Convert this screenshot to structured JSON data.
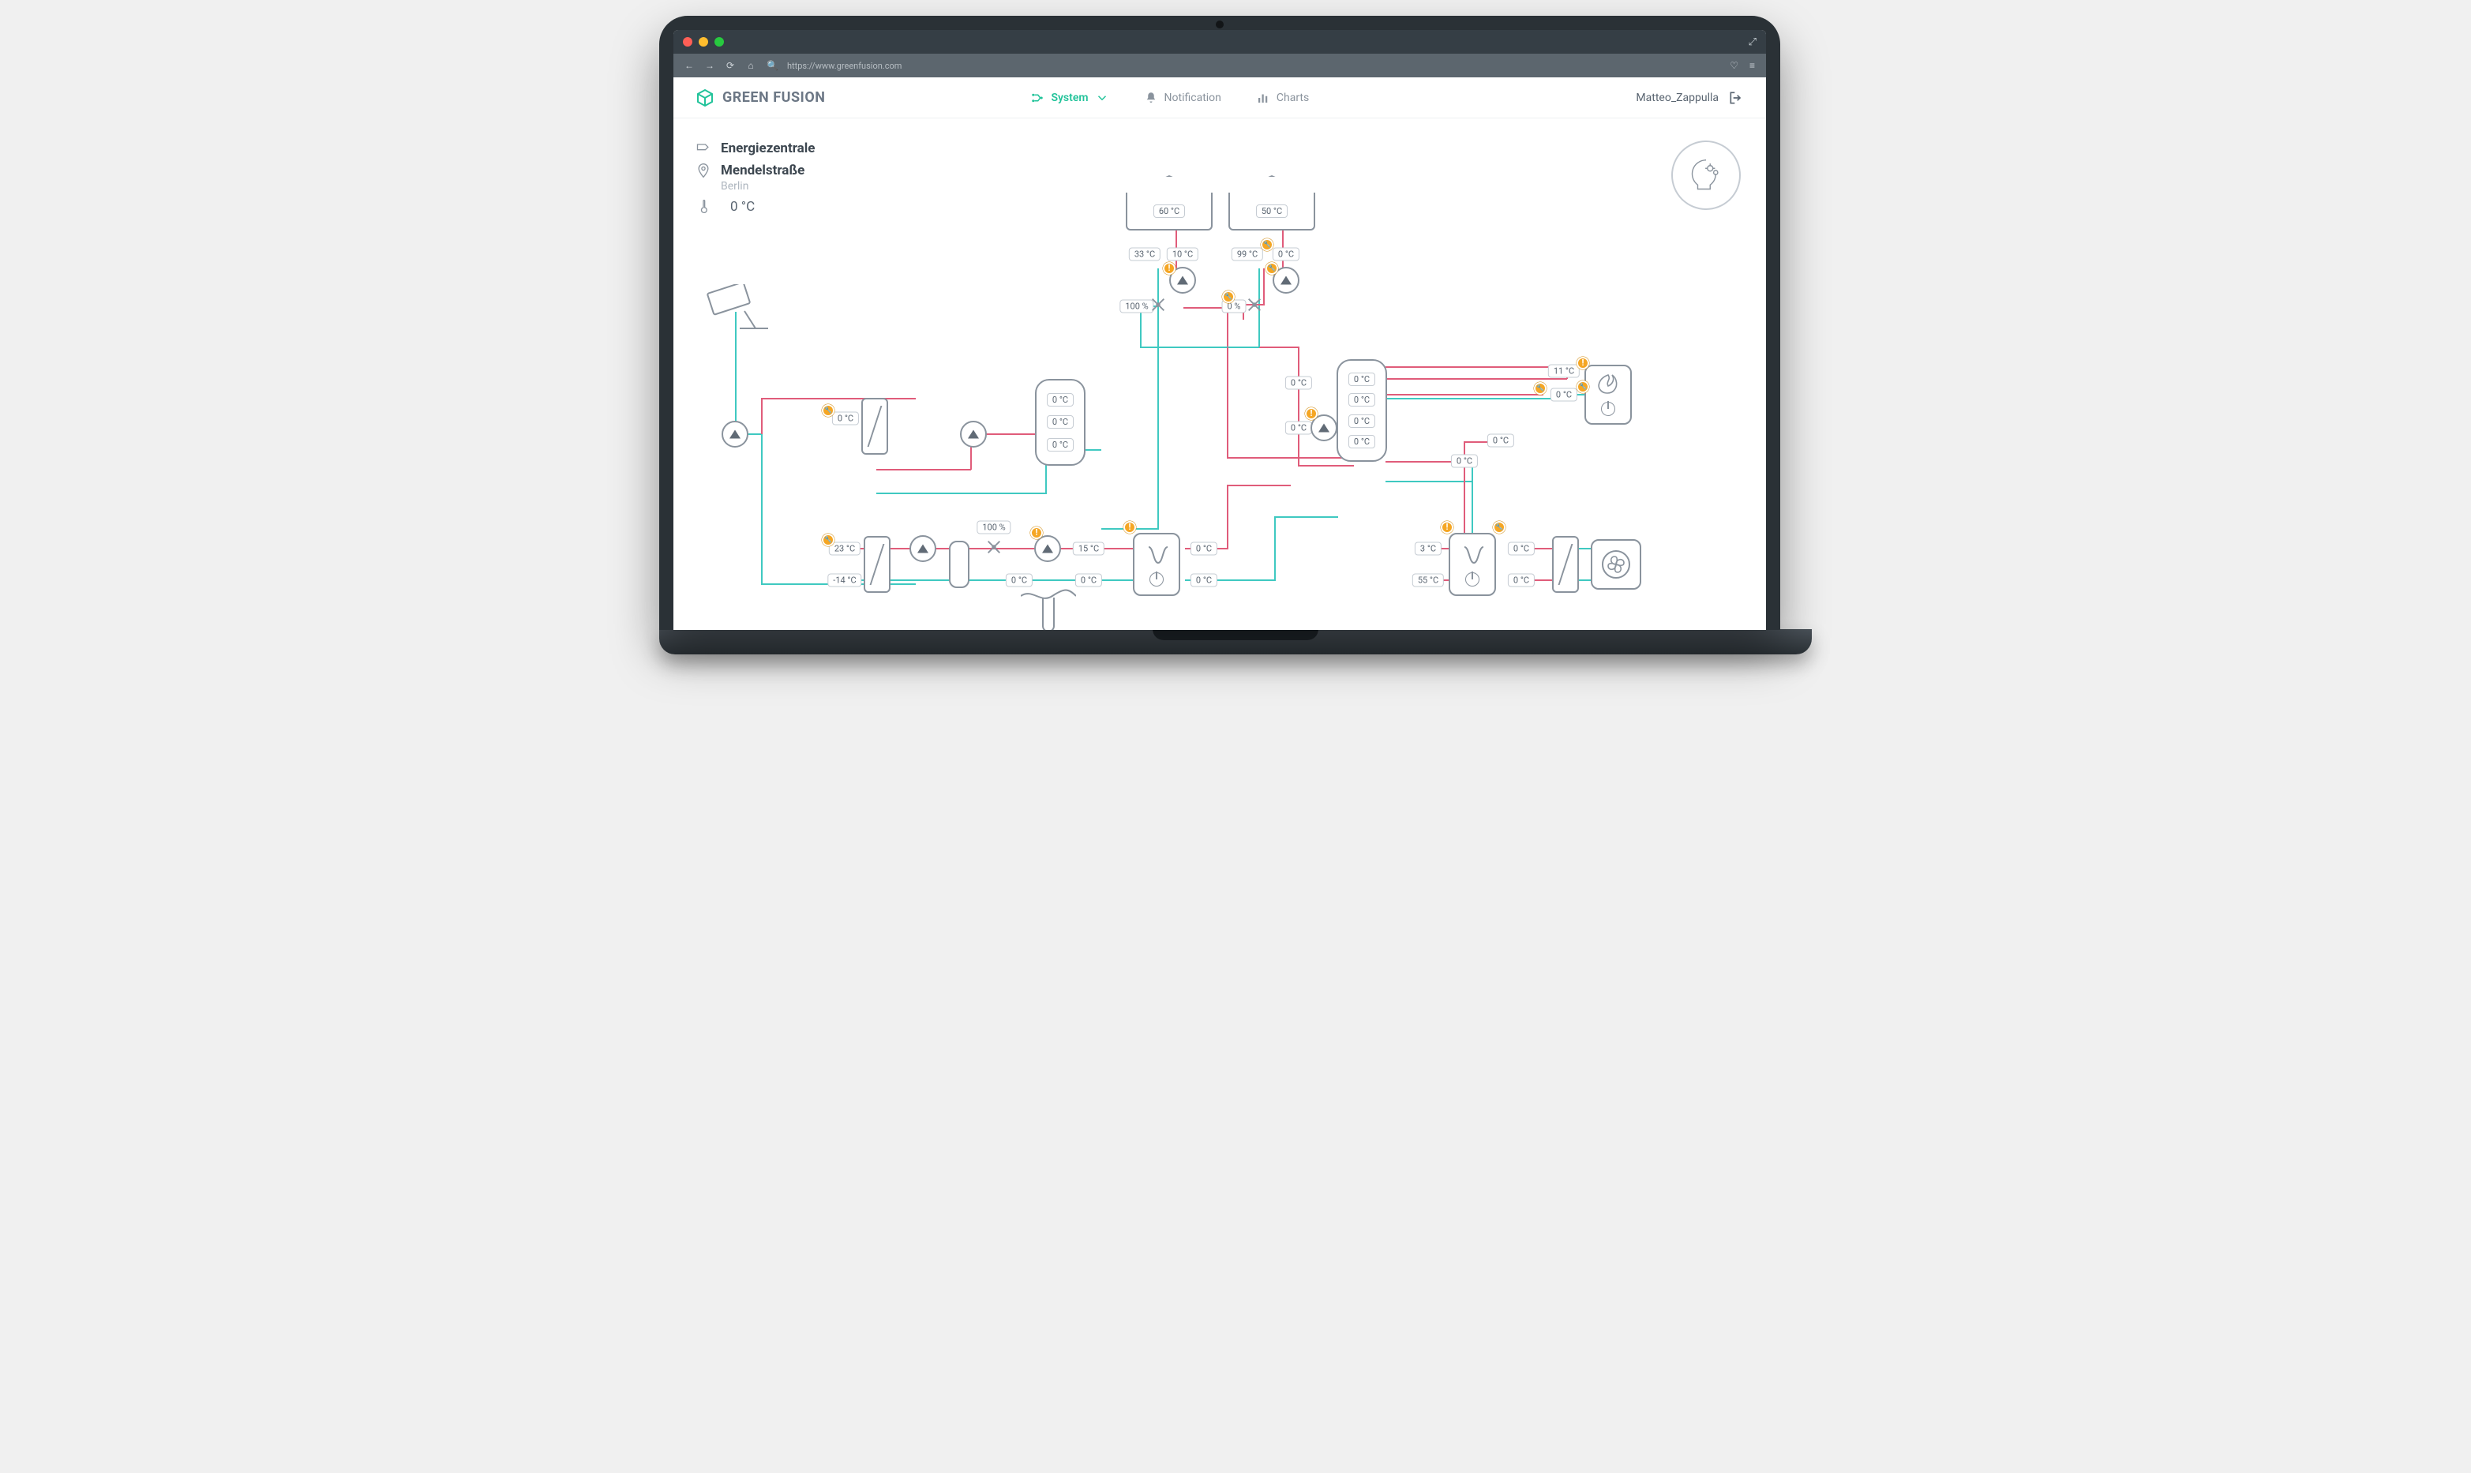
{
  "browser": {
    "url": "https://www.greenfusion.com"
  },
  "brand": "GREEN FUSION",
  "nav": {
    "system": "System",
    "notification": "Notification",
    "charts": "Charts"
  },
  "user": "Matteo_Zappulla",
  "site": {
    "name": "Energiezentrale",
    "street": "Mendelstraße",
    "city": "Berlin",
    "outdoor_temp": "0 °C"
  },
  "buildings": {
    "a": "60 °C",
    "b": "50 °C"
  },
  "building_a": {
    "supply": "33 °C",
    "return": "10 °C",
    "valve": "100 %"
  },
  "building_b": {
    "supply": "99 °C",
    "return": "0 °C",
    "valve": "0 %"
  },
  "solar": {
    "t1": "0 °C",
    "t2": "23 °C",
    "t3": "-14 °C"
  },
  "geo_valve": "100 %",
  "hp_left": {
    "in": "15 °C",
    "out1": "0 °C",
    "out2": "0 °C",
    "mix": "0 °C"
  },
  "buffer_a": {
    "t1": "0 °C",
    "t2": "0 °C",
    "t3": "0 °C"
  },
  "buffer_b": {
    "t1": "0 °C",
    "t2": "0 °C",
    "t3": "0 °C",
    "t4": "0 °C",
    "left_in": "0 °C",
    "left_out": "0 °C"
  },
  "boiler": {
    "supply": "11 °C",
    "return": "0 °C"
  },
  "right_mid": {
    "a": "0 °C",
    "b": "0 °C"
  },
  "hp_right": {
    "in1": "3 °C",
    "in2": "55 °C",
    "out1": "0 °C",
    "out2": "0 °C"
  },
  "line_mid1": "0 °C",
  "line_mid2": "0 °C"
}
